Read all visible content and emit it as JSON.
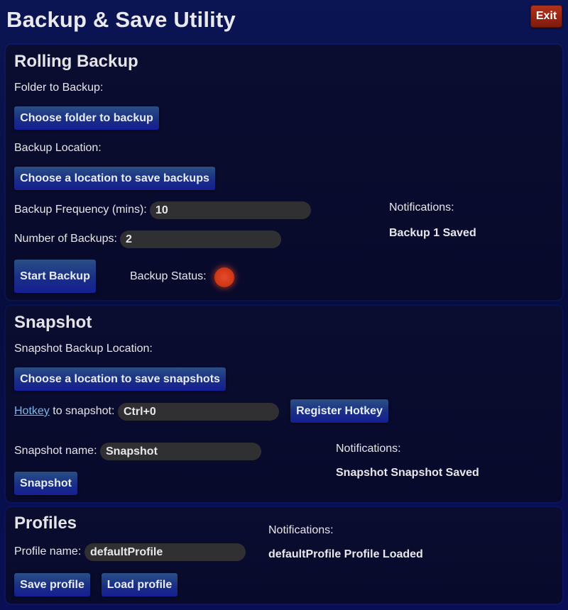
{
  "app": {
    "title": "Backup & Save Utility",
    "exit_label": "Exit"
  },
  "rolling_backup": {
    "title": "Rolling Backup",
    "folder_label": "Folder to Backup:",
    "choose_folder_button": "Choose folder to backup",
    "location_label": "Backup Location:",
    "choose_location_button": "Choose a location to save backups",
    "frequency_label": "Backup Frequency (mins):",
    "frequency_value": "10",
    "count_label": "Number of Backups:",
    "count_value": "2",
    "start_button": "Start Backup",
    "status_label": "Backup Status:",
    "status_color": "#e0401f",
    "notifications_label": "Notifications:",
    "notification_message": "Backup 1 Saved"
  },
  "snapshot": {
    "title": "Snapshot",
    "location_label": "Snapshot Backup Location:",
    "choose_location_button": "Choose a location to save snapshots",
    "hotkey_link": "Hotkey",
    "hotkey_label_rest": " to snapshot:",
    "hotkey_value": "Ctrl+0",
    "register_button": "Register Hotkey",
    "name_label": "Snapshot name:",
    "name_value": "Snapshot",
    "snapshot_button": "Snapshot",
    "notifications_label": "Notifications:",
    "notification_message": "Snapshot Snapshot Saved"
  },
  "profiles": {
    "title": "Profiles",
    "name_label": "Profile name:",
    "name_value": "defaultProfile",
    "save_button": "Save profile",
    "load_button": "Load profile",
    "notifications_label": "Notifications:",
    "notification_message": "defaultProfile Profile Loaded"
  }
}
